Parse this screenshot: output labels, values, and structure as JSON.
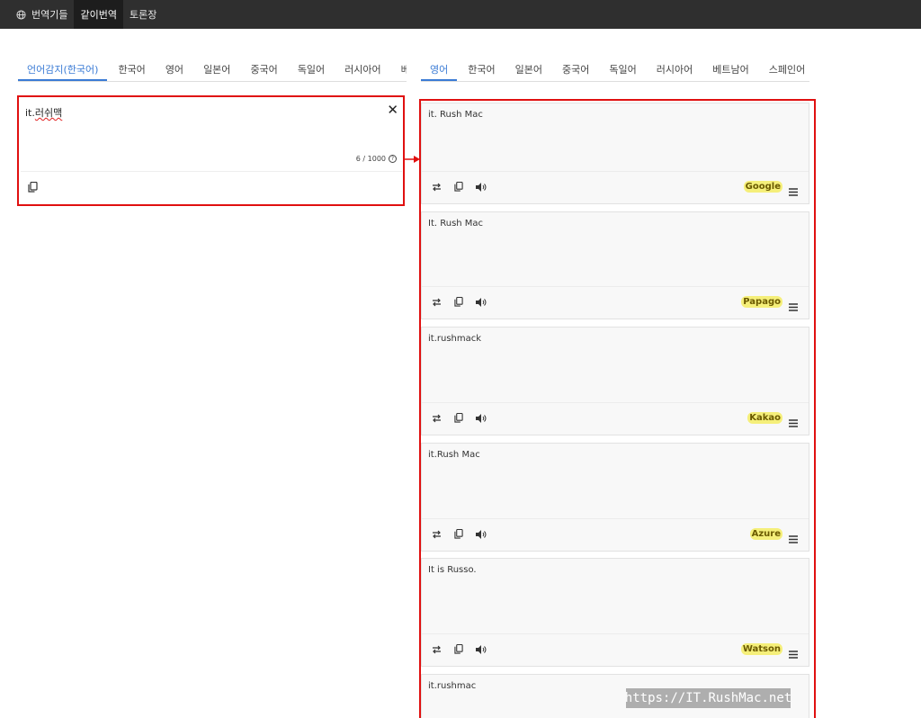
{
  "nav": [
    {
      "label": "번역기들",
      "icon": "globe-icon"
    },
    {
      "label": "같이번역"
    },
    {
      "label": "토론장"
    }
  ],
  "source_tabs": [
    "언어감지(한국어)",
    "한국어",
    "영어",
    "일본어",
    "중국어",
    "독일어",
    "러시아어",
    "베"
  ],
  "target_tabs": [
    "영어",
    "한국어",
    "일본어",
    "중국어",
    "독일어",
    "러시아어",
    "베트남어",
    "스페인어"
  ],
  "source": {
    "text_prefix": "it.",
    "text_korean": "러쉬맥",
    "counter": "6 / 1000",
    "clear": "✕"
  },
  "results": [
    {
      "text": "it. Rush Mac",
      "engine": "Google"
    },
    {
      "text": "It. Rush Mac",
      "engine": "Papago"
    },
    {
      "text": "it.rushmack",
      "engine": "Kakao"
    },
    {
      "text": "it.Rush Mac",
      "engine": "Azure"
    },
    {
      "text": "It is Russo.",
      "engine": "Watson"
    },
    {
      "text": "it.rushmac",
      "engine": ""
    }
  ],
  "watermark": "https://IT.RushMac.net",
  "colors": {
    "highlight": "#e01010",
    "accent": "#3a7bd5",
    "engine_badge": "#f5ef7a"
  }
}
